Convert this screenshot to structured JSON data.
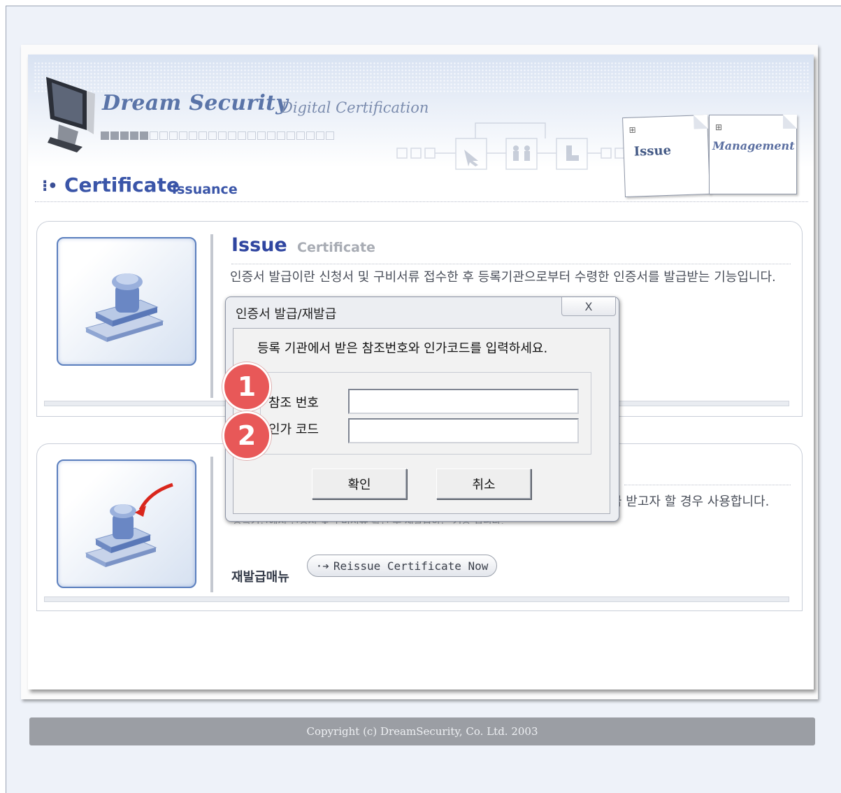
{
  "header": {
    "brand_title": "Dream Security",
    "brand_subtitle": "Digital Certification",
    "progress_squares_on": 5,
    "progress_squares_total": 24
  },
  "tabs": {
    "issue_label": "Issue",
    "management_label": "Management"
  },
  "section": {
    "title_main": "Certificate",
    "title_sub": "Issuance"
  },
  "issue_panel": {
    "title_main": "Issue",
    "title_sub": "Certificate",
    "description": "인증서 발급이란 신청서 및 구비서류 접수한 후 등록기관으로부터 수령한 인증서를 발급받는 기능입니다."
  },
  "reissue_panel": {
    "description_visible_tail": "급 받고자 할 경우 사용합니다.",
    "description_partial_line": "등록기관에서 신청서 및 구비서류 확인 후 재발급하는 기능 입니다.",
    "menu_label": "재발급매뉴",
    "button_label": "Reissue Certificate Now"
  },
  "dialog": {
    "title": "인증서 발급/재발급",
    "close_glyph": "X",
    "instruction": "등록 기관에서 받은 참조번호와 인가코드를 입력하세요.",
    "ref_label": "참조 번호",
    "auth_label": "인가 코드",
    "ref_value": "",
    "auth_value": "",
    "ok_label": "확인",
    "cancel_label": "취소"
  },
  "steps": {
    "step1": "1",
    "step2": "2"
  },
  "footer": {
    "copyright": "Copyright (c) DreamSecurity, Co. Ltd. 2003"
  },
  "colors": {
    "brand_blue": "#3a55a8",
    "step_badge": "#e85858",
    "footer_bar": "#9b9ea4"
  }
}
